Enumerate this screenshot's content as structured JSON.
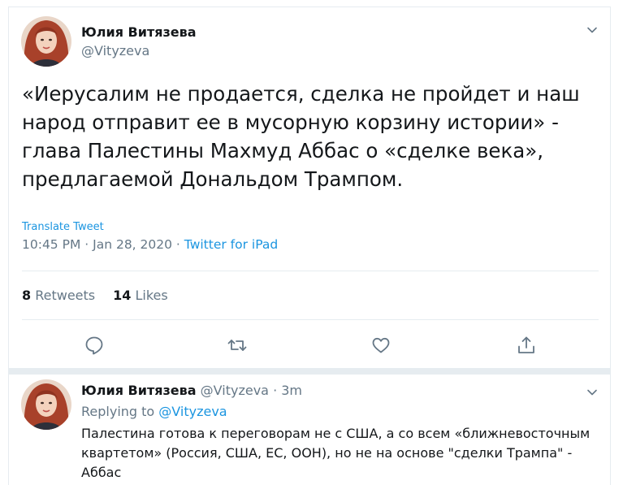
{
  "tweet": {
    "author_name": "Юлия Витязева",
    "author_handle": "@Vityzeva",
    "text": "«Иерусалим не продается, сделка не пройдет и наш народ отправит ее в мусорную корзину истории» - глава Палестины Махмуд Аббас о «сделке века», предлагаемой Дональдом Трампом.",
    "translate_label": "Translate Tweet",
    "time": "10:45 PM",
    "date": "Jan 28, 2020",
    "separator": "·",
    "source": "Twitter for iPad",
    "retweets_count": "8",
    "retweets_label": "Retweets",
    "likes_count": "14",
    "likes_label": "Likes"
  },
  "actions": {
    "reply_icon": "speech-bubble-icon",
    "retweet_icon": "retweet-arrows-icon",
    "like_icon": "heart-icon",
    "share_icon": "share-upload-icon"
  },
  "reply": {
    "author_name": "Юлия Витязева",
    "author_handle": "@Vityzeva",
    "separator": "·",
    "time_ago": "3m",
    "replying_label": "Replying to",
    "replying_to": "@Vityzeva",
    "text": "Палестина готова к переговорам не с США, а со всем «ближневосточным квартетом» (Россия, США, ЕС, ООН), но не на основе \"сделки Трампа\" - Аббас"
  },
  "colors": {
    "link_blue": "#1b95e0",
    "secondary_gray": "#657786",
    "text_dark": "#14171a",
    "divider": "#e6ecf0"
  }
}
